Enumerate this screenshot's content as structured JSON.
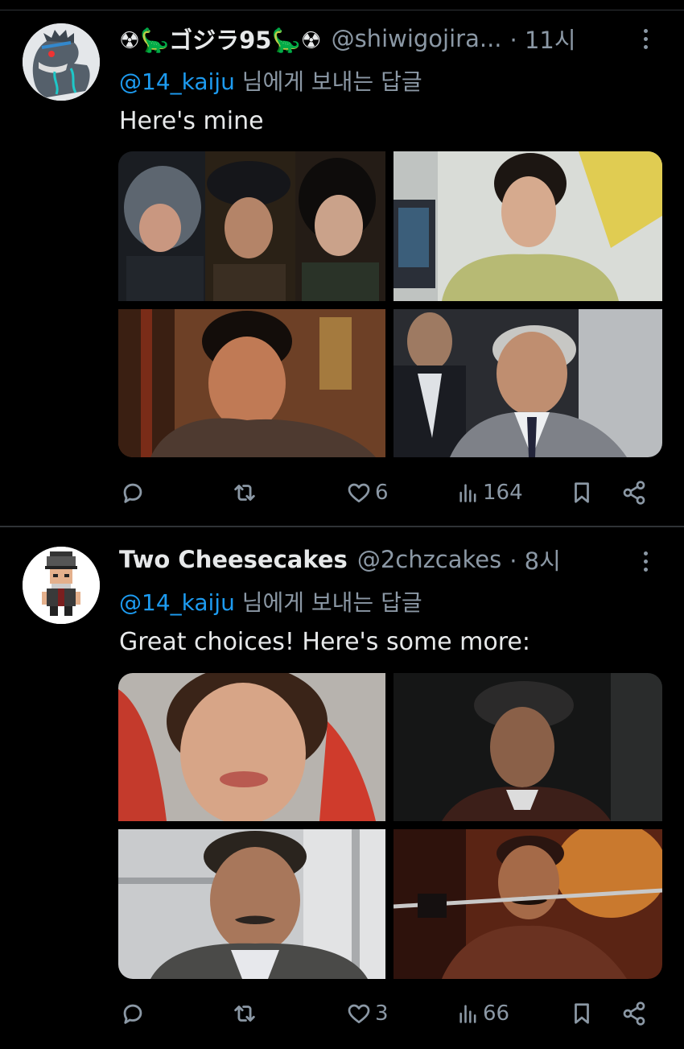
{
  "tweets": [
    {
      "name": "☢🦕ゴジラ95🦕☢",
      "handle": "@shiwigojira...",
      "time": "· 11시",
      "reply_mention": "@14_kaiju",
      "reply_suffix": " 님에게 보내는 답글",
      "text": "Here's mine",
      "stats": {
        "replies": "",
        "retweets": "",
        "likes": "6",
        "views": "164"
      }
    },
    {
      "name": "Two Cheesecakes",
      "handle": "@2chzcakes",
      "time": "· 8시",
      "reply_mention": "@14_kaiju",
      "reply_suffix": " 님에게 보내는 답글",
      "text": "Great choices! Here's some more:",
      "stats": {
        "replies": "",
        "retweets": "",
        "likes": "3",
        "views": "66"
      }
    }
  ],
  "icons": [
    "reply-icon",
    "retweet-icon",
    "like-icon",
    "views-icon",
    "bookmark-icon",
    "share-icon",
    "more-icon"
  ],
  "colors": {
    "background": "#000000",
    "text": "#e7e9ea",
    "muted": "#8b98a5",
    "link": "#1d9bf0",
    "divider": "#2f3336"
  }
}
